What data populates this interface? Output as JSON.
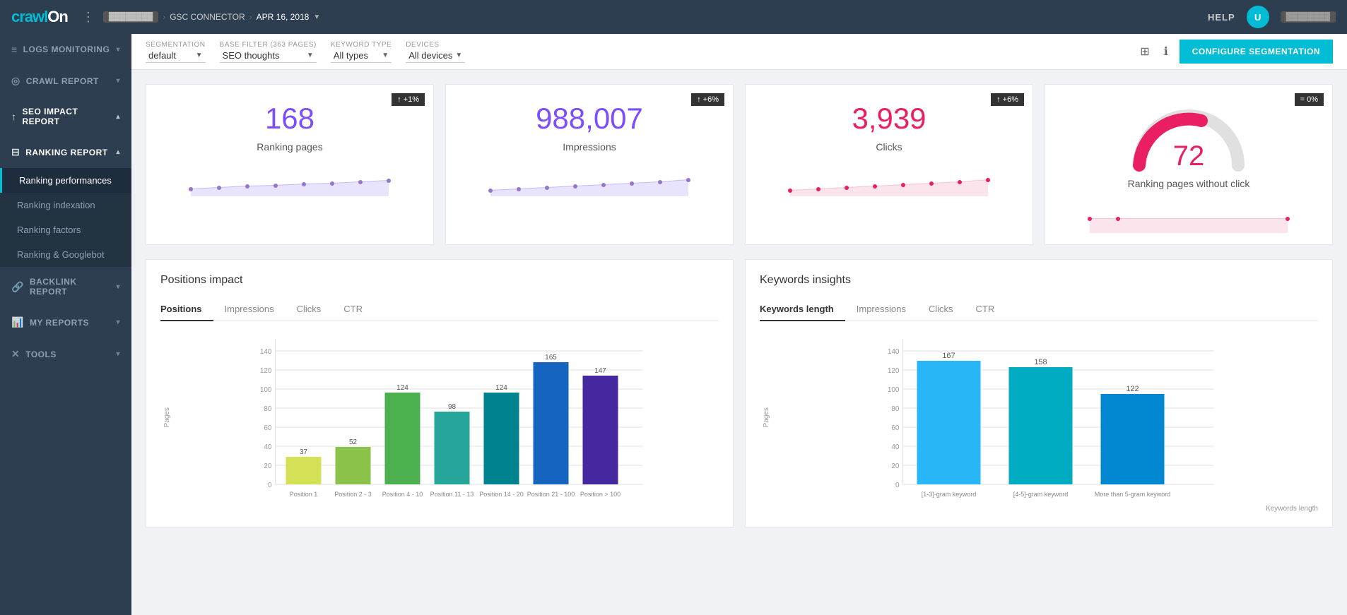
{
  "topbar": {
    "logo": "On",
    "logo_highlight": "crawl",
    "breadcrumb": [
      {
        "label": "BLURRED",
        "active": false
      },
      {
        "label": "GSC CONNECTOR",
        "active": false
      },
      {
        "label": "APR 16, 2018",
        "active": true
      }
    ],
    "help_label": "HELP",
    "username": "BLURRED",
    "avatar_initials": "U"
  },
  "sidebar": {
    "items": [
      {
        "id": "logs-monitoring",
        "label": "LOGS MONITORING",
        "icon": "≡",
        "expanded": false,
        "has_sub": true
      },
      {
        "id": "crawl-report",
        "label": "CRAWL REPORT",
        "icon": "⊘",
        "expanded": false,
        "has_sub": true
      },
      {
        "id": "seo-impact-report",
        "label": "SEO IMPACT REPORT",
        "icon": "↑",
        "expanded": true,
        "has_sub": true
      },
      {
        "id": "ranking-report",
        "label": "RANKING REPORT",
        "icon": "⊟",
        "expanded": true,
        "has_sub": true
      },
      {
        "id": "backlink-report",
        "label": "BACKLINK REPORT",
        "icon": "🔗",
        "expanded": false,
        "has_sub": true
      },
      {
        "id": "my-reports",
        "label": "MY REPORTS",
        "icon": "📊",
        "expanded": false,
        "has_sub": true
      },
      {
        "id": "tools",
        "label": "TOOLS",
        "icon": "✕",
        "expanded": false,
        "has_sub": true
      }
    ],
    "subitems": [
      {
        "label": "Ranking performances",
        "active": true,
        "parent": "ranking-report"
      },
      {
        "label": "Ranking indexation",
        "active": false,
        "parent": "ranking-report"
      },
      {
        "label": "Ranking factors",
        "active": false,
        "parent": "ranking-report"
      },
      {
        "label": "Ranking & Googlebot",
        "active": false,
        "parent": "ranking-report"
      }
    ]
  },
  "filters": {
    "segmentation_label": "Segmentation",
    "segmentation_value": "default",
    "base_filter_label": "Base filter (363 pages)",
    "base_filter_value": "SEO thoughts",
    "keyword_type_label": "Keyword type",
    "keyword_type_value": "All types",
    "devices_label": "Devices",
    "devices_value": "All devices",
    "configure_btn": "CONFIGURE SEGMENTATION"
  },
  "kpis": [
    {
      "value": "168",
      "label": "Ranking pages",
      "color": "purple",
      "badge": "↑ +1%",
      "sparkline_color": "#c5b8f8"
    },
    {
      "value": "988,007",
      "label": "Impressions",
      "color": "purple",
      "badge": "↑ +6%",
      "sparkline_color": "#c5b8f8"
    },
    {
      "value": "3,939",
      "label": "Clicks",
      "color": "pink",
      "badge": "↑ +6%",
      "sparkline_color": "#f8c1d4"
    },
    {
      "value": "72",
      "label": "Ranking pages without click",
      "color": "pink",
      "badge": "= 0%",
      "is_gauge": true
    }
  ],
  "positions_impact": {
    "title": "Positions impact",
    "tabs": [
      "Positions",
      "Impressions",
      "Clicks",
      "CTR"
    ],
    "active_tab": "Positions",
    "y_label": "Pages",
    "bars": [
      {
        "label": "Position 1",
        "value": 37,
        "color": "#d4e157"
      },
      {
        "label": "Position 2 - 3",
        "value": 52,
        "color": "#8bc34a"
      },
      {
        "label": "Position 4 - 10",
        "value": 124,
        "color": "#4caf50"
      },
      {
        "label": "Position 11 - 13",
        "value": 98,
        "color": "#26a69a"
      },
      {
        "label": "Position 14 - 20",
        "value": 124,
        "color": "#00838f"
      },
      {
        "label": "Position 21 - 100",
        "value": 165,
        "color": "#1565c0"
      },
      {
        "label": "Position > 100",
        "value": 147,
        "color": "#4527a0"
      }
    ],
    "y_max": 180
  },
  "keywords_insights": {
    "title": "Keywords insights",
    "tabs": [
      "Keywords length",
      "Impressions",
      "Clicks",
      "CTR"
    ],
    "active_tab": "Keywords length",
    "y_label": "Pages",
    "footer_label": "Keywords length",
    "bars": [
      {
        "label": "[1-3]-gram keyword",
        "value": 167,
        "color": "#29b6f6"
      },
      {
        "label": "[4-5]-gram keyword",
        "value": 158,
        "color": "#00acc1"
      },
      {
        "label": "More than 5-gram keyword",
        "value": 122,
        "color": "#0288d1"
      }
    ],
    "y_max": 180
  }
}
